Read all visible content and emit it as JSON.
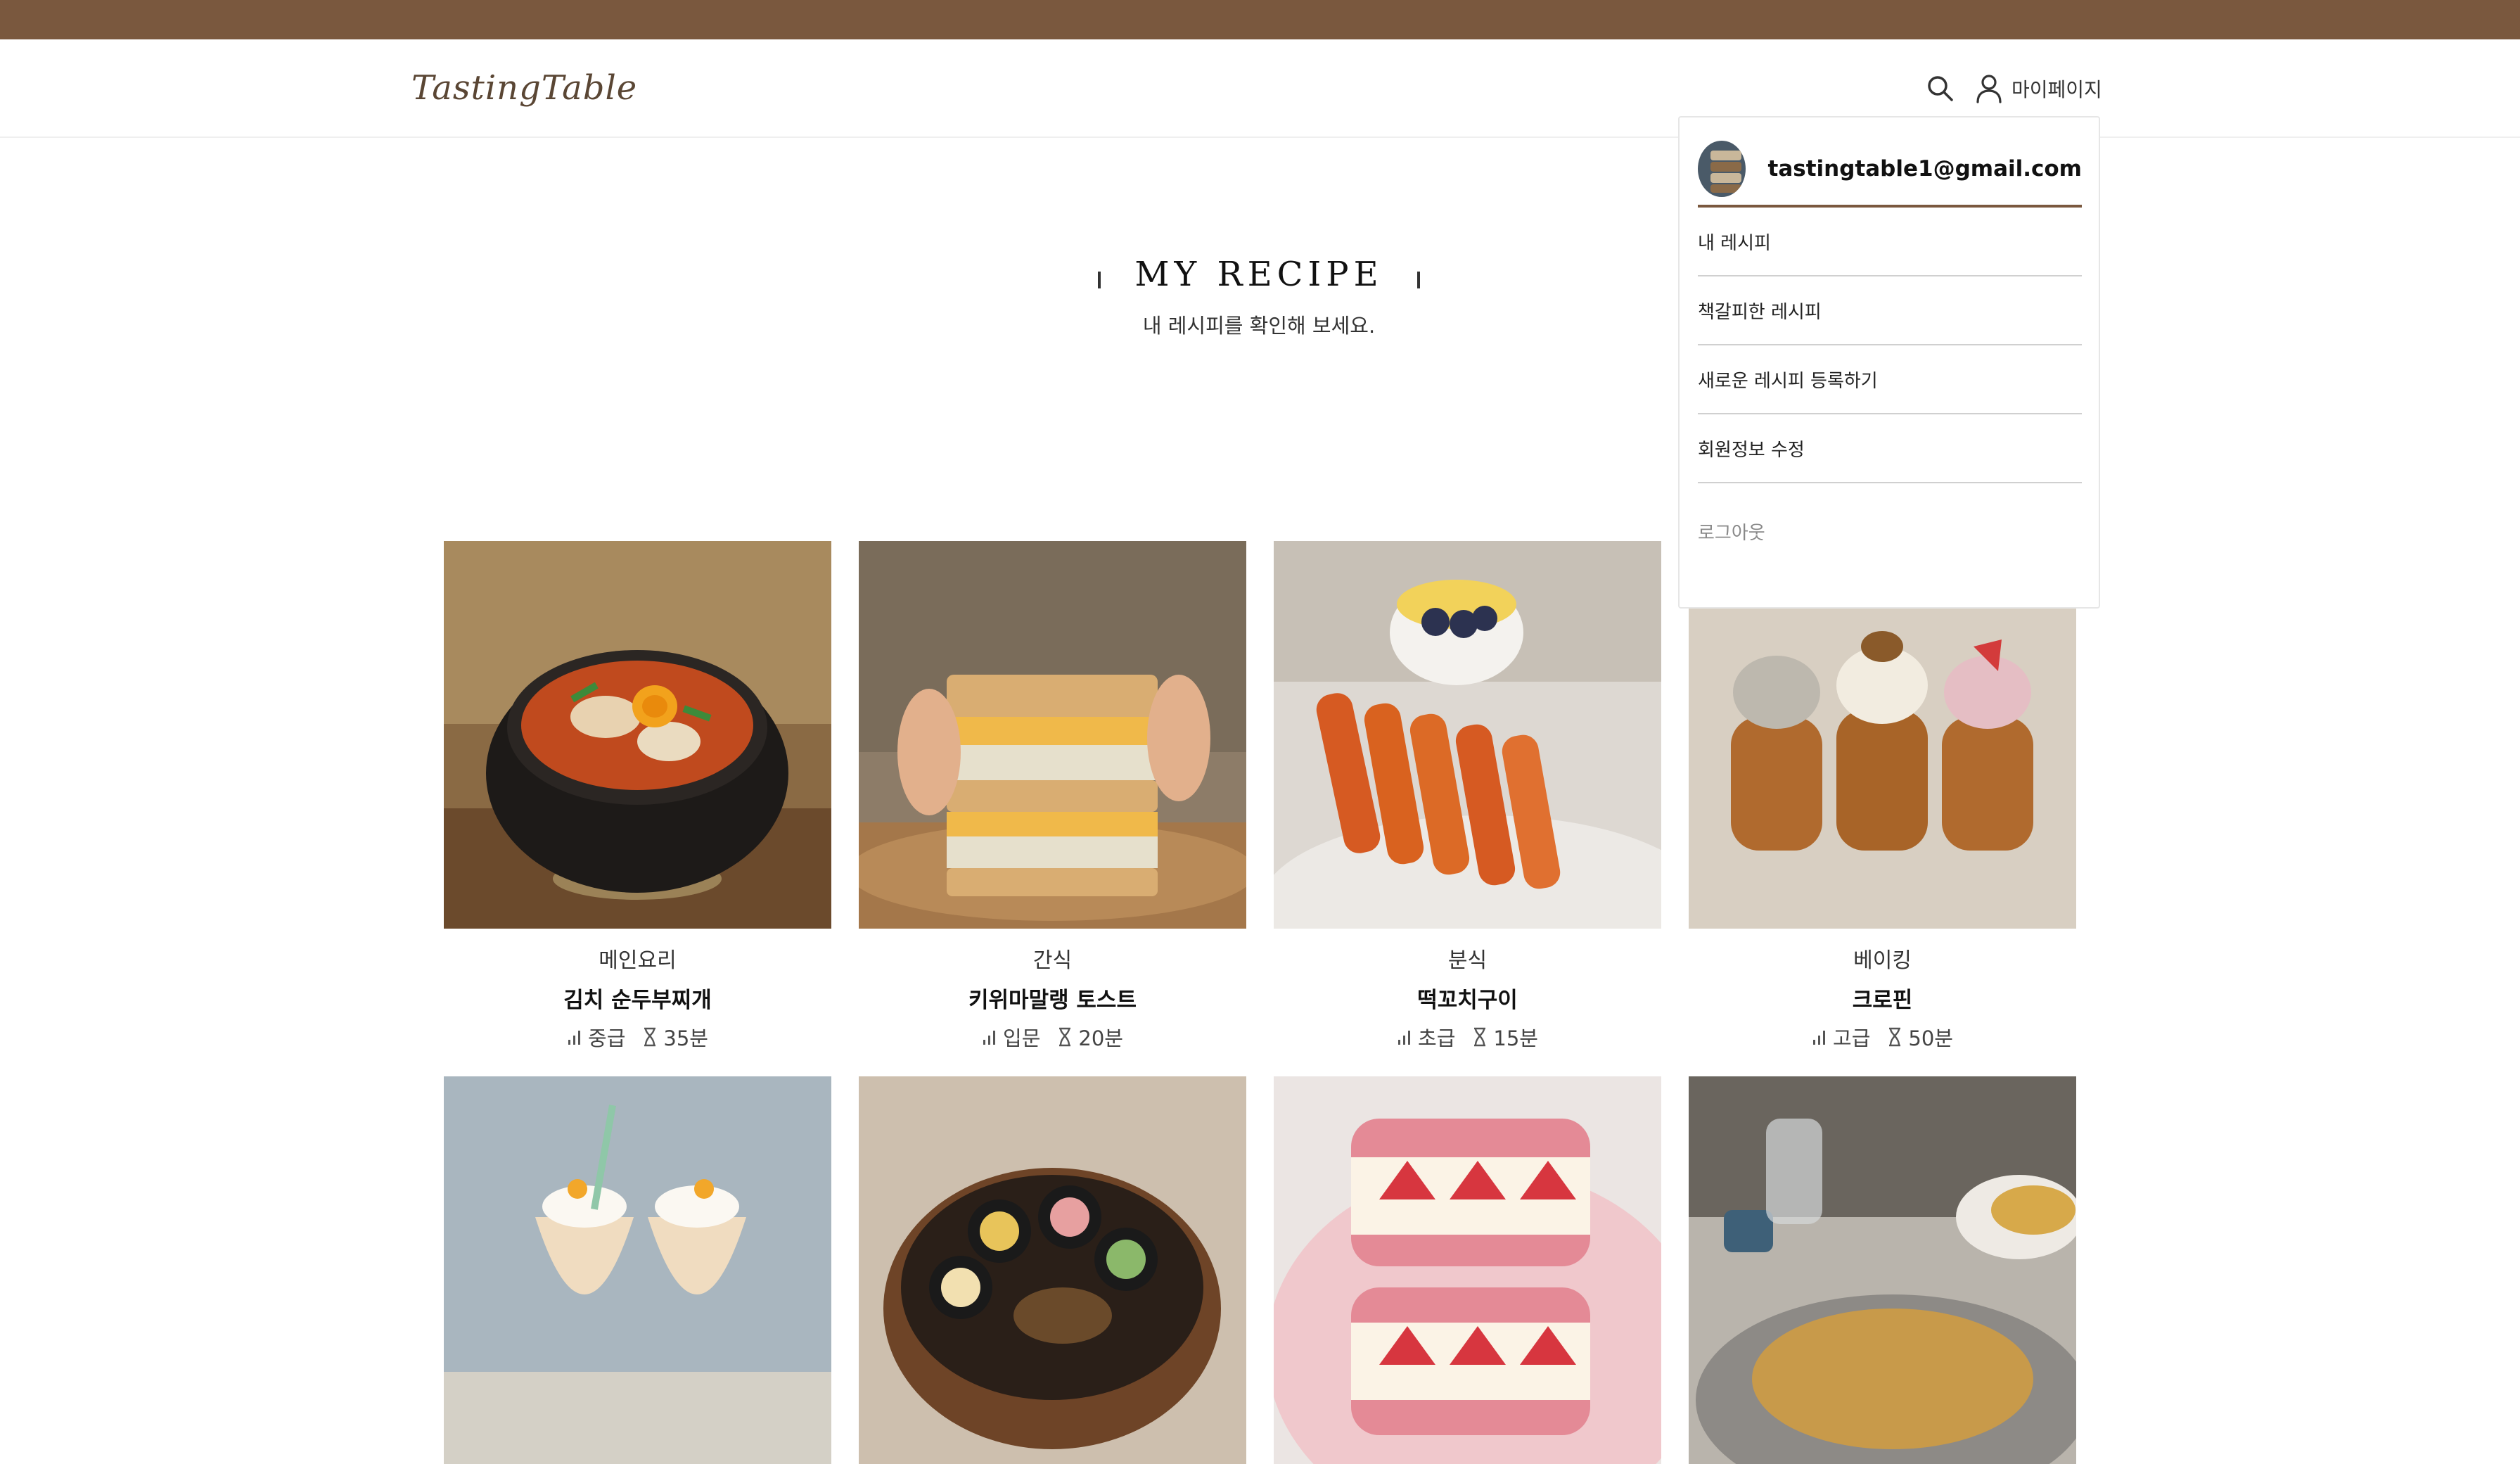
{
  "header": {
    "logo": "TastingTable",
    "mypage_label": "마이페이지"
  },
  "section": {
    "title": "MY RECIPE",
    "subtitle": "내 레시피를 확인해 보세요."
  },
  "dropdown": {
    "email": "tastingtable1@gmail.com",
    "items": [
      "내 레시피",
      "책갈피한 레시피",
      "새로운 레시피 등록하기",
      "회원정보 수정"
    ],
    "logout": "로그아웃"
  },
  "recipes": [
    {
      "category": "메인요리",
      "name": "김치 순두부찌개",
      "level": "중급",
      "time": "35분"
    },
    {
      "category": "간식",
      "name": "키위마말랭 토스트",
      "level": "입문",
      "time": "20분"
    },
    {
      "category": "분식",
      "name": "떡꼬치구이",
      "level": "초급",
      "time": "15분"
    },
    {
      "category": "베이킹",
      "name": "크로핀",
      "level": "고급",
      "time": "50분"
    }
  ],
  "colors": {
    "brand_brown": "#7a583e",
    "divider": "#d0d0d0"
  },
  "icons": [
    "search-icon",
    "user-icon",
    "level-icon",
    "hourglass-icon"
  ]
}
